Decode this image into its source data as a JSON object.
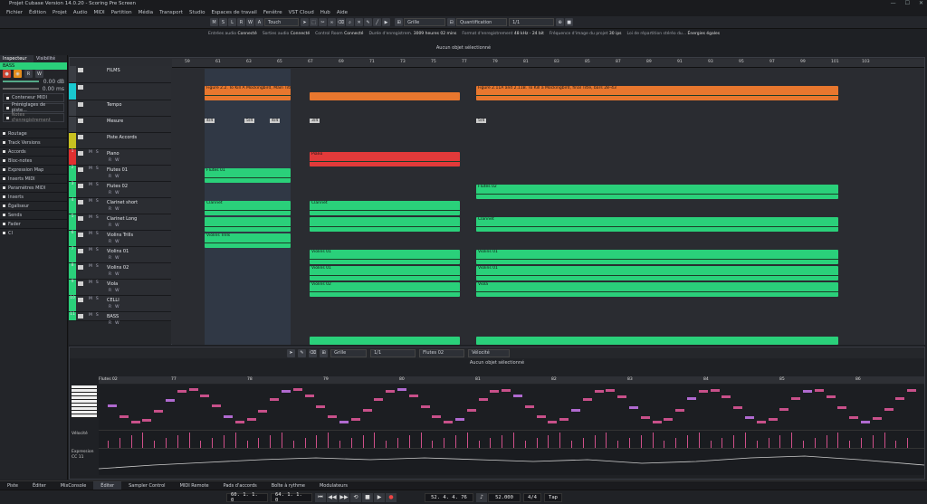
{
  "window": {
    "title": "Projet Cubase Version 14.0.20 - Scoring Pre Screen",
    "controls": [
      "—",
      "☐",
      "✕"
    ]
  },
  "menu": [
    "Fichier",
    "Édition",
    "Projet",
    "Audio",
    "MIDI",
    "Partition",
    "Média",
    "Transport",
    "Studio",
    "Espaces de travail",
    "Fenêtre",
    "VST Cloud",
    "Hub",
    "Aide"
  ],
  "toolbar": {
    "mode_buttons": [
      "M",
      "S",
      "L",
      "R",
      "W",
      "A"
    ],
    "touch": "Touch",
    "grid_label": "Grille",
    "quantize_label": "Quantification",
    "quantize_value": "1/1",
    "zoom_label": "1/1"
  },
  "infoline": [
    {
      "label": "Entrées audio",
      "value": "Connecté"
    },
    {
      "label": "Sorties audio",
      "value": "Connecté"
    },
    {
      "label": "Control Room",
      "value": "Connecté"
    },
    {
      "label": "Durée d'enregistrem.",
      "value": "3009 heures 02 mins"
    },
    {
      "label": "Format d'enregistrement",
      "value": "48 kHz - 24 bit"
    },
    {
      "label": "Fréquence d'image du projet",
      "value": "30 ips"
    },
    {
      "label": "Loi de répartition stéréo du...",
      "value": "Énergies égales"
    }
  ],
  "selection_banner": "Aucun objet sélectionné",
  "left_tabs": [
    "Inspecteur",
    "Visibilité"
  ],
  "inspector": {
    "track_name": "BASS",
    "volume": "0.00 dB",
    "pan": "0.00 ms",
    "midi_out": "Conteneur MIDI",
    "program": "Préréglages de piste...",
    "notes": "Notes d'enregistrement",
    "sections": [
      "Routage",
      "Track Versions",
      "Accords",
      "Bloc-notes",
      "Expression Map",
      "Inserts MIDI",
      "Paramètres MIDI",
      "Inserts",
      "Égaliseur",
      "Sends",
      "Fader",
      "CI"
    ]
  },
  "ruler_labels": [
    "59",
    "61",
    "63",
    "65",
    "67",
    "69",
    "71",
    "73",
    "75",
    "77",
    "79",
    "81",
    "83",
    "85",
    "87",
    "89",
    "91",
    "93",
    "95",
    "97",
    "99",
    "101",
    "103"
  ],
  "tracks": [
    {
      "num": "",
      "name": "FILMS",
      "color": "#3a3d43",
      "h": 19
    },
    {
      "num": "",
      "name": "",
      "color": "#19c8cf",
      "h": 19
    },
    {
      "num": "",
      "name": "Tempo",
      "color": "#3a3d43",
      "h": 18
    },
    {
      "num": "",
      "name": "Mesure",
      "color": "#3a3d43",
      "h": 18
    },
    {
      "num": "",
      "name": "Piste Accords",
      "color": "#c8c020",
      "h": 18
    },
    {
      "num": "1",
      "name": "Piano",
      "color": "#e03030",
      "h": 18
    },
    {
      "num": "2",
      "name": "Flutes 01",
      "color": "#2ad07a",
      "h": 18
    },
    {
      "num": "3",
      "name": "Flutes 02",
      "color": "#2ad07a",
      "h": 18
    },
    {
      "num": "4",
      "name": "Clarinet short",
      "color": "#2ad07a",
      "h": 18
    },
    {
      "num": "5",
      "name": "Clarinet Long",
      "color": "#2ad07a",
      "h": 18
    },
    {
      "num": "6",
      "name": "Violins Trills",
      "color": "#2ad07a",
      "h": 18
    },
    {
      "num": "7",
      "name": "Violins 01",
      "color": "#2ad07a",
      "h": 18
    },
    {
      "num": "8",
      "name": "Violins 02",
      "color": "#2ad07a",
      "h": 18
    },
    {
      "num": "9",
      "name": "Viola",
      "color": "#2ad07a",
      "h": 18
    },
    {
      "num": "10",
      "name": "CELLI",
      "color": "#2ad07a",
      "h": 18
    },
    {
      "num": "11",
      "name": "BASS",
      "color": "#2ad07a",
      "h": 10
    }
  ],
  "track_buttons": {
    "m": "M",
    "s": "S",
    "r": "R",
    "w": "W"
  },
  "arranger": {
    "marker1": "Figure 2.2. To Kill A Mockingbird, Main Title.",
    "marker2": "Figure 2.11A and 2.11B. To Kill a Mockingbird, final Title, bars 28–43",
    "sig_a": "4/4",
    "sig_b": "5/4",
    "sig_c": "4/4",
    "sig_d": "3/4",
    "sig_e": "5/4"
  },
  "clip_labels": {
    "piano": "Piano",
    "flutes01": "Flutes 01",
    "flutes02": "Flutes 02",
    "clarinet": "Clarinet",
    "violins_trills": "Violins Trills",
    "violins01": "Violins 01",
    "violins02": "Violins 02",
    "viola": "Viola"
  },
  "lower": {
    "banner": "Aucun objet sélectionné",
    "part": "Flutes 02",
    "grid": "Grille",
    "quant": "1/1",
    "velocity_label": "Vélocité",
    "cc_label": "Expression",
    "cc_sub": "CC 11",
    "ruler": [
      "77",
      "78",
      "79",
      "80",
      "81",
      "82",
      "83",
      "84",
      "85",
      "86"
    ]
  },
  "status_tabs": [
    "Piste",
    "Éditer",
    "MixConsole",
    "Éditer",
    "Sampler Control",
    "MIDI Remote",
    "Pads d'accords",
    "Boîte à rythme",
    "Modulateurs"
  ],
  "transport": {
    "left_locator": "60. 1. 1. 0",
    "right_locator": "64. 1. 1. 0",
    "position": "52. 4. 4. 76",
    "tempo": "52.000",
    "signature": "4/4",
    "tap": "Tap"
  }
}
